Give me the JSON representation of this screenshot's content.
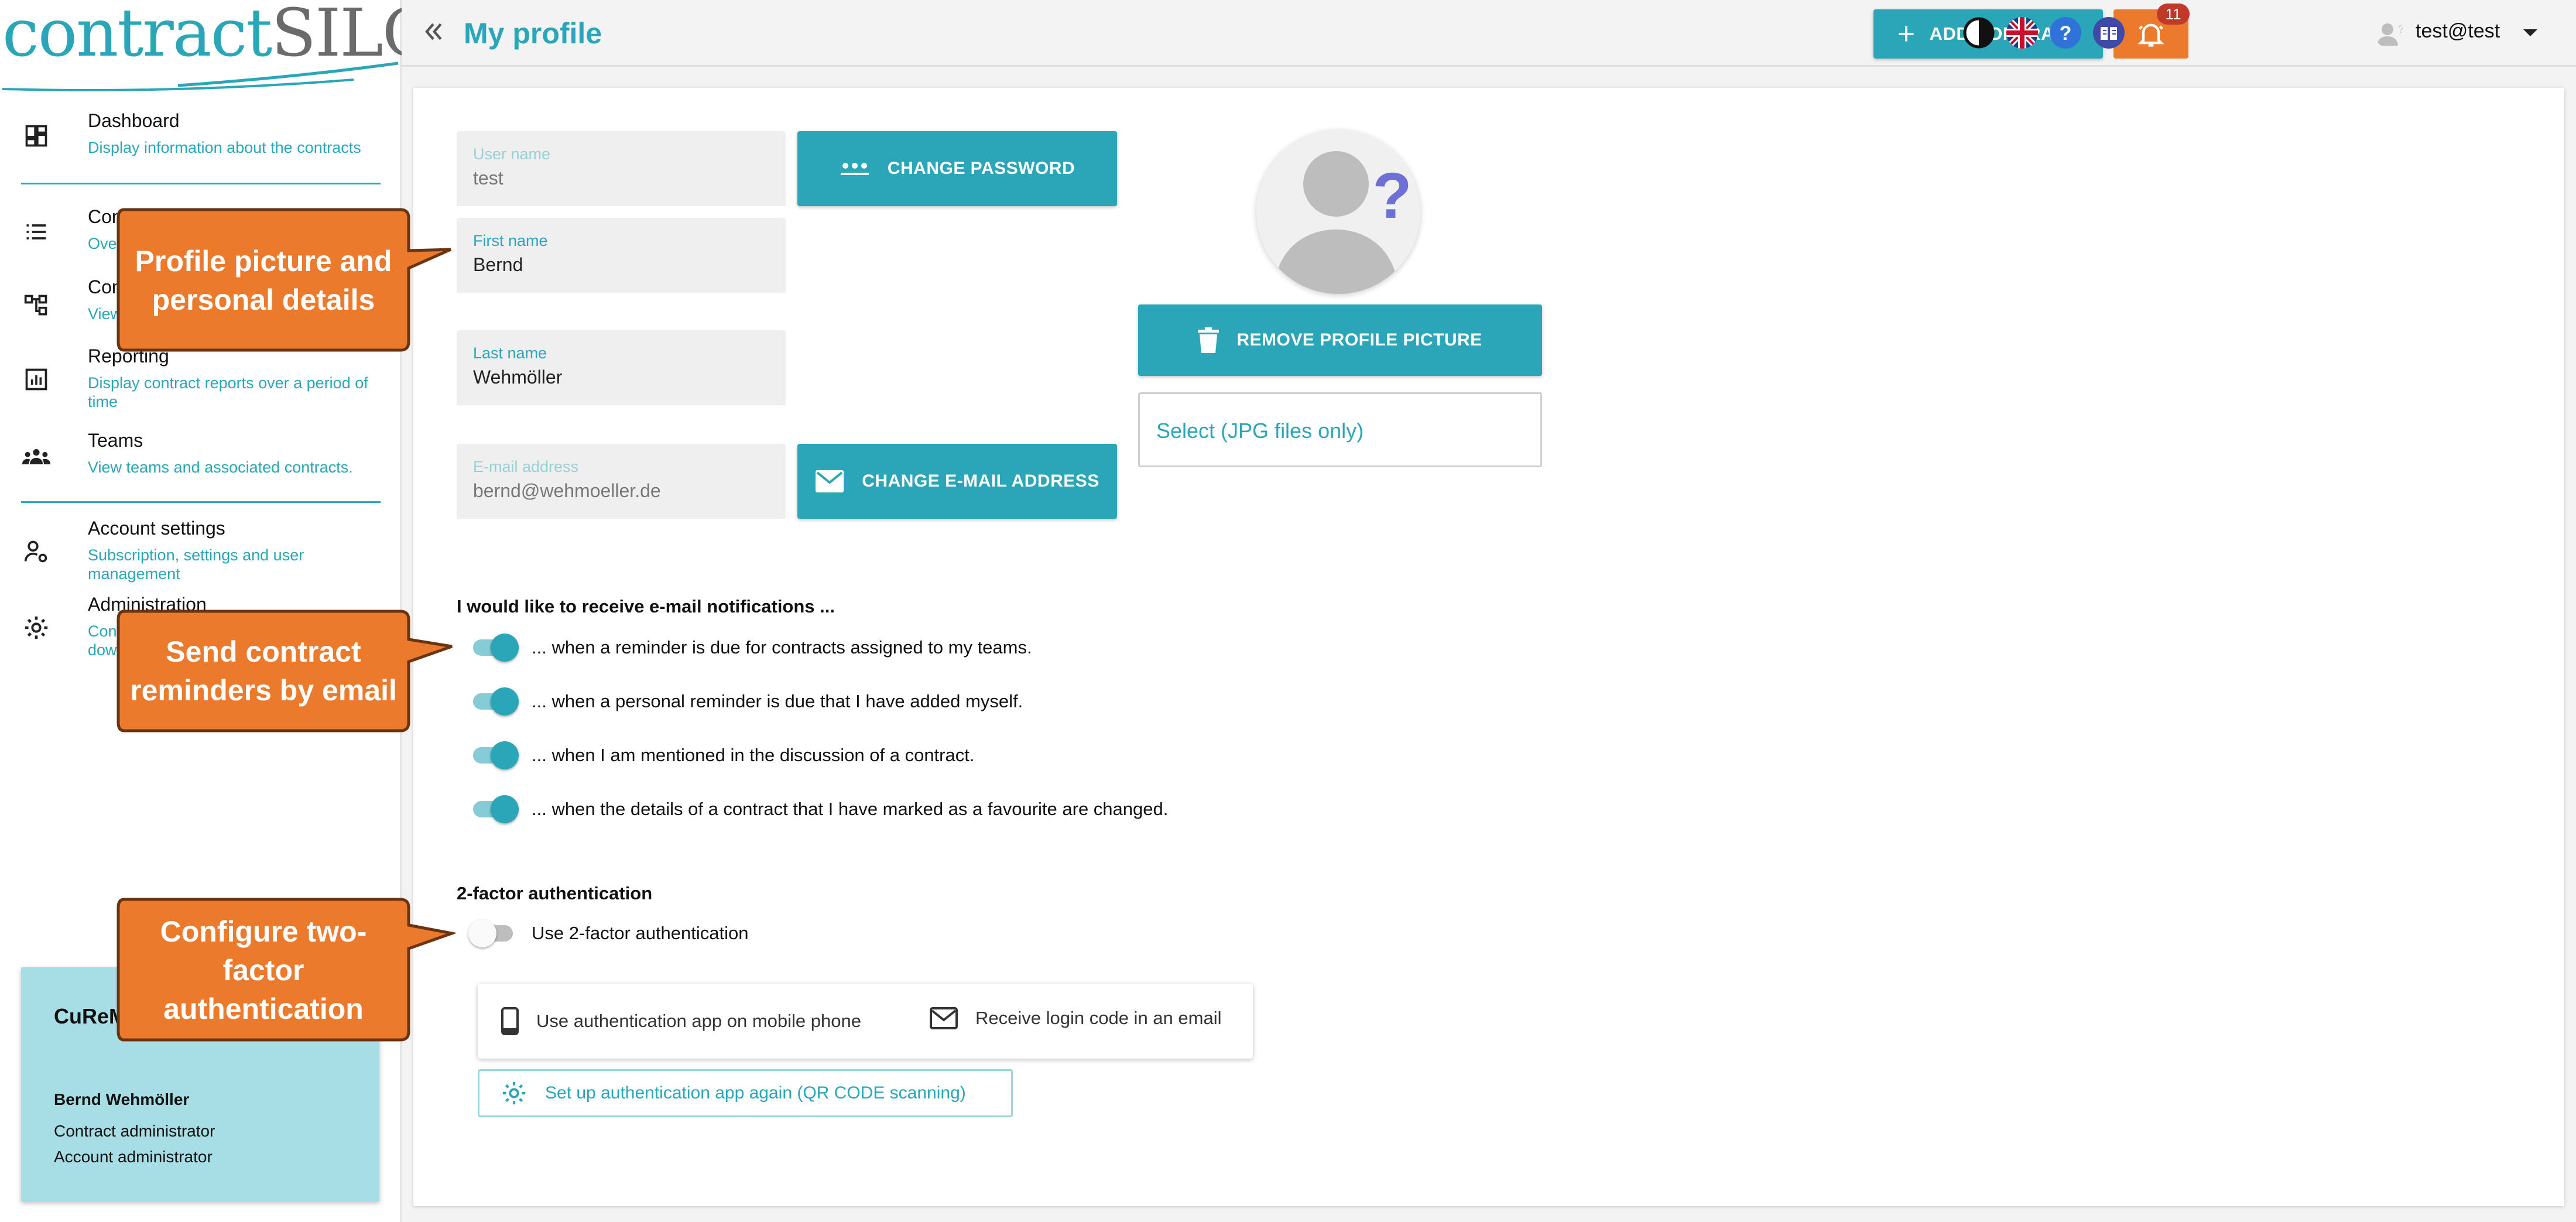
{
  "app": {
    "logo_part1": "contract",
    "logo_part2": "SILO",
    "accent": "#2aa6b8",
    "orange": "#ec7a2c"
  },
  "header": {
    "title": "My profile",
    "add_contract": "ADD CONTRACT",
    "notification_count": "11",
    "user": "test@test"
  },
  "sidebar": {
    "items": [
      {
        "title": "Dashboard",
        "subtitle": "Display information about the contracts",
        "icon": "dashboard-icon"
      },
      {
        "title": "Contr",
        "subtitle": "Ove",
        "icon": "list-icon"
      },
      {
        "title": "Con",
        "subtitle": "View",
        "icon": "hierarchy-icon"
      },
      {
        "title": "Reporting",
        "subtitle": "Display contract reports over a period of time",
        "icon": "report-icon"
      },
      {
        "title": "Teams",
        "subtitle": "View teams and associated contracts.",
        "icon": "teams-icon"
      },
      {
        "title": "Account settings",
        "subtitle": "Subscription, settings and user management",
        "icon": "user-settings-icon"
      },
      {
        "title": "Administration",
        "subtitle": "Con dow",
        "icon": "gear-icon"
      }
    ],
    "account": {
      "company": "CuReM (DEV)",
      "user": "Bernd Wehmöller",
      "role1": "Contract administrator",
      "role2": "Account administrator"
    }
  },
  "profile": {
    "username": {
      "label": "User name",
      "value": "test"
    },
    "first_name": {
      "label": "First name",
      "value": "Bernd"
    },
    "last_name": {
      "label": "Last name",
      "value": "Wehmöller"
    },
    "email": {
      "label": "E-mail address",
      "value": "bernd@wehmoeller.de"
    },
    "change_password": "CHANGE PASSWORD",
    "change_email": "CHANGE E-MAIL ADDRESS",
    "remove_picture": "REMOVE PROFILE PICTURE",
    "file_select": "Select (JPG files only)"
  },
  "notifications": {
    "title": "I would like to receive e-mail notifications ...",
    "options": [
      {
        "text": "... when a reminder is due for contracts assigned to my teams.",
        "on": true
      },
      {
        "text": "... when a personal reminder is due that I have added myself.",
        "on": true
      },
      {
        "text": "... when I am mentioned in the discussion of a contract.",
        "on": true
      },
      {
        "text": "... when the details of a contract that I have marked as a favourite are changed.",
        "on": true
      }
    ]
  },
  "twofa": {
    "title": "2-factor authentication",
    "toggle_label": "Use 2-factor authentication",
    "toggle_on": false,
    "option_app": "Use authentication app on mobile phone",
    "option_email": "Receive login code in an email",
    "setup": "Set up authentication app again (QR CODE scanning)"
  },
  "callouts": {
    "profile": "Profile picture and personal details",
    "reminders": "Send contract reminders by email",
    "twofa": "Configure two-factor authentication"
  }
}
